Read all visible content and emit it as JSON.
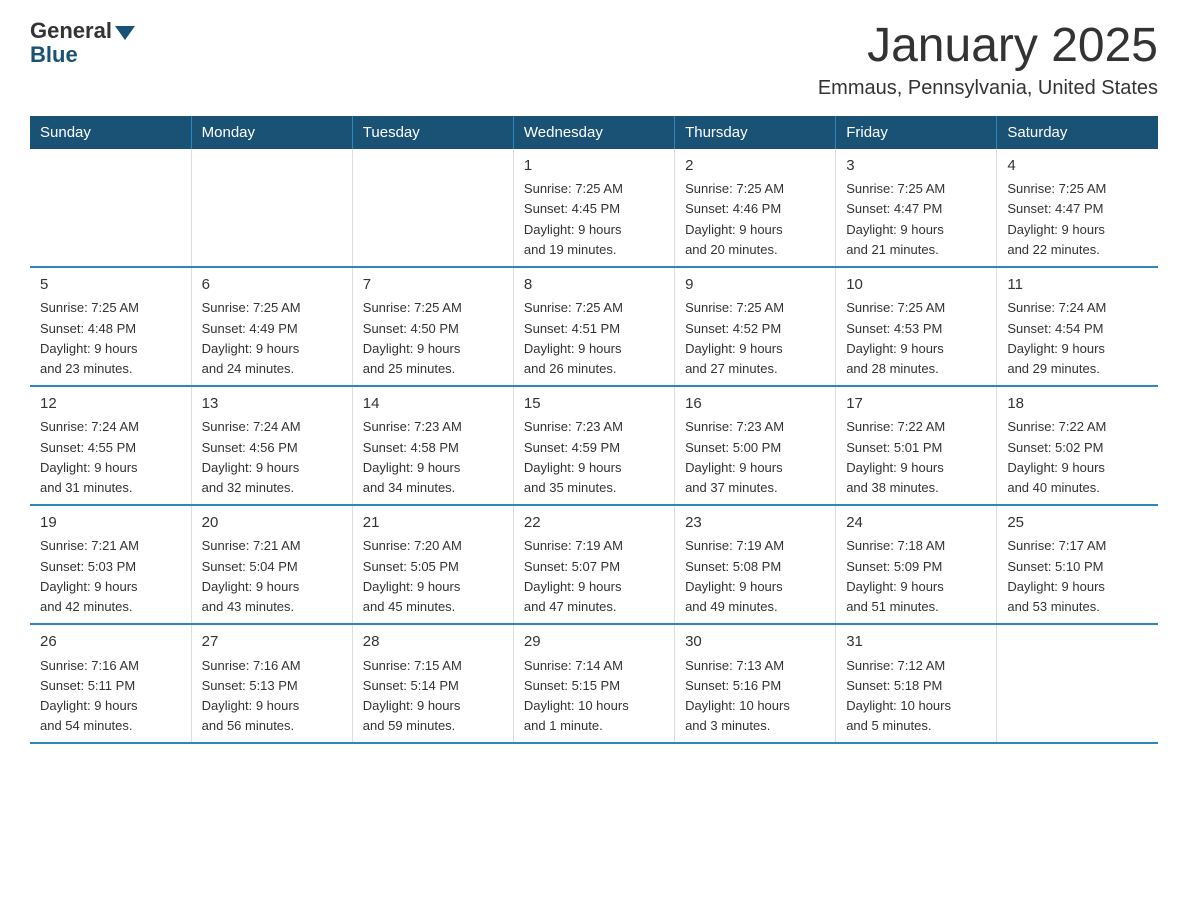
{
  "header": {
    "title": "January 2025",
    "subtitle": "Emmaus, Pennsylvania, United States",
    "logo_general": "General",
    "logo_blue": "Blue"
  },
  "weekdays": [
    "Sunday",
    "Monday",
    "Tuesday",
    "Wednesday",
    "Thursday",
    "Friday",
    "Saturday"
  ],
  "weeks": [
    [
      {
        "day": "",
        "info": ""
      },
      {
        "day": "",
        "info": ""
      },
      {
        "day": "",
        "info": ""
      },
      {
        "day": "1",
        "info": "Sunrise: 7:25 AM\nSunset: 4:45 PM\nDaylight: 9 hours\nand 19 minutes."
      },
      {
        "day": "2",
        "info": "Sunrise: 7:25 AM\nSunset: 4:46 PM\nDaylight: 9 hours\nand 20 minutes."
      },
      {
        "day": "3",
        "info": "Sunrise: 7:25 AM\nSunset: 4:47 PM\nDaylight: 9 hours\nand 21 minutes."
      },
      {
        "day": "4",
        "info": "Sunrise: 7:25 AM\nSunset: 4:47 PM\nDaylight: 9 hours\nand 22 minutes."
      }
    ],
    [
      {
        "day": "5",
        "info": "Sunrise: 7:25 AM\nSunset: 4:48 PM\nDaylight: 9 hours\nand 23 minutes."
      },
      {
        "day": "6",
        "info": "Sunrise: 7:25 AM\nSunset: 4:49 PM\nDaylight: 9 hours\nand 24 minutes."
      },
      {
        "day": "7",
        "info": "Sunrise: 7:25 AM\nSunset: 4:50 PM\nDaylight: 9 hours\nand 25 minutes."
      },
      {
        "day": "8",
        "info": "Sunrise: 7:25 AM\nSunset: 4:51 PM\nDaylight: 9 hours\nand 26 minutes."
      },
      {
        "day": "9",
        "info": "Sunrise: 7:25 AM\nSunset: 4:52 PM\nDaylight: 9 hours\nand 27 minutes."
      },
      {
        "day": "10",
        "info": "Sunrise: 7:25 AM\nSunset: 4:53 PM\nDaylight: 9 hours\nand 28 minutes."
      },
      {
        "day": "11",
        "info": "Sunrise: 7:24 AM\nSunset: 4:54 PM\nDaylight: 9 hours\nand 29 minutes."
      }
    ],
    [
      {
        "day": "12",
        "info": "Sunrise: 7:24 AM\nSunset: 4:55 PM\nDaylight: 9 hours\nand 31 minutes."
      },
      {
        "day": "13",
        "info": "Sunrise: 7:24 AM\nSunset: 4:56 PM\nDaylight: 9 hours\nand 32 minutes."
      },
      {
        "day": "14",
        "info": "Sunrise: 7:23 AM\nSunset: 4:58 PM\nDaylight: 9 hours\nand 34 minutes."
      },
      {
        "day": "15",
        "info": "Sunrise: 7:23 AM\nSunset: 4:59 PM\nDaylight: 9 hours\nand 35 minutes."
      },
      {
        "day": "16",
        "info": "Sunrise: 7:23 AM\nSunset: 5:00 PM\nDaylight: 9 hours\nand 37 minutes."
      },
      {
        "day": "17",
        "info": "Sunrise: 7:22 AM\nSunset: 5:01 PM\nDaylight: 9 hours\nand 38 minutes."
      },
      {
        "day": "18",
        "info": "Sunrise: 7:22 AM\nSunset: 5:02 PM\nDaylight: 9 hours\nand 40 minutes."
      }
    ],
    [
      {
        "day": "19",
        "info": "Sunrise: 7:21 AM\nSunset: 5:03 PM\nDaylight: 9 hours\nand 42 minutes."
      },
      {
        "day": "20",
        "info": "Sunrise: 7:21 AM\nSunset: 5:04 PM\nDaylight: 9 hours\nand 43 minutes."
      },
      {
        "day": "21",
        "info": "Sunrise: 7:20 AM\nSunset: 5:05 PM\nDaylight: 9 hours\nand 45 minutes."
      },
      {
        "day": "22",
        "info": "Sunrise: 7:19 AM\nSunset: 5:07 PM\nDaylight: 9 hours\nand 47 minutes."
      },
      {
        "day": "23",
        "info": "Sunrise: 7:19 AM\nSunset: 5:08 PM\nDaylight: 9 hours\nand 49 minutes."
      },
      {
        "day": "24",
        "info": "Sunrise: 7:18 AM\nSunset: 5:09 PM\nDaylight: 9 hours\nand 51 minutes."
      },
      {
        "day": "25",
        "info": "Sunrise: 7:17 AM\nSunset: 5:10 PM\nDaylight: 9 hours\nand 53 minutes."
      }
    ],
    [
      {
        "day": "26",
        "info": "Sunrise: 7:16 AM\nSunset: 5:11 PM\nDaylight: 9 hours\nand 54 minutes."
      },
      {
        "day": "27",
        "info": "Sunrise: 7:16 AM\nSunset: 5:13 PM\nDaylight: 9 hours\nand 56 minutes."
      },
      {
        "day": "28",
        "info": "Sunrise: 7:15 AM\nSunset: 5:14 PM\nDaylight: 9 hours\nand 59 minutes."
      },
      {
        "day": "29",
        "info": "Sunrise: 7:14 AM\nSunset: 5:15 PM\nDaylight: 10 hours\nand 1 minute."
      },
      {
        "day": "30",
        "info": "Sunrise: 7:13 AM\nSunset: 5:16 PM\nDaylight: 10 hours\nand 3 minutes."
      },
      {
        "day": "31",
        "info": "Sunrise: 7:12 AM\nSunset: 5:18 PM\nDaylight: 10 hours\nand 5 minutes."
      },
      {
        "day": "",
        "info": ""
      }
    ]
  ]
}
